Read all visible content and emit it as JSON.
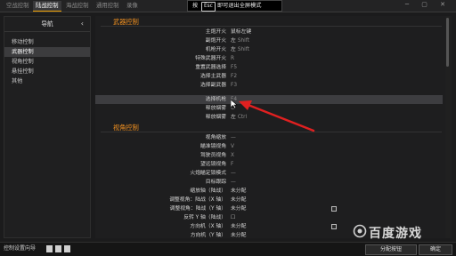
{
  "top_tabs": [
    "空战控制",
    "陆战控制",
    "海战控制",
    "通用控制",
    "录像"
  ],
  "esc_tip": {
    "pre": "按",
    "key": "Esc",
    "post": "即可退出全屏模式"
  },
  "window_buttons": "─ ▢ ✕",
  "sidebar": {
    "title": "导航",
    "items": [
      "移动控制",
      "武器控制",
      "视角控制",
      "悬挂控制",
      "其他"
    ]
  },
  "sections": {
    "weapons": "武器控制",
    "view": "视角控制"
  },
  "weapon_rows": [
    {
      "label": "主炮开火",
      "value": "鼠标左键"
    },
    {
      "label": "副炮开火",
      "prefix": "左",
      "value": "Shift"
    },
    {
      "label": "机枪开火",
      "prefix": "左",
      "value": "Shift"
    },
    {
      "label": "特殊武器开火",
      "value": "R"
    },
    {
      "label": "重置武器选择",
      "value": "F5"
    },
    {
      "label": "选择主武器",
      "value": "F2"
    },
    {
      "label": "选择副武器",
      "value": "F3"
    },
    {
      "label": "选择机枪",
      "value": "F4"
    },
    {
      "label": "释放烟雾",
      "value": "C"
    },
    {
      "label": "释放烟雾",
      "prefix": "左",
      "value": "Ctrl"
    }
  ],
  "view_rows": [
    {
      "label": "视角缩放",
      "value": "—"
    },
    {
      "label": "瞄准镜视角",
      "value": "V"
    },
    {
      "label": "驾驶员视角",
      "value": "X"
    },
    {
      "label": "望远镜视角",
      "value": "F"
    },
    {
      "label": "火炮瞄定锁模式",
      "value": "—"
    },
    {
      "label": "目标跟踪",
      "value": "—"
    },
    {
      "label": "缩放轴（陆战）",
      "value": "未分配"
    },
    {
      "label": "调整视角：陆战（X 轴）",
      "value": "未分配"
    },
    {
      "label": "调整视角：陆战（Y 轴）",
      "value": "未分配"
    },
    {
      "label": "反转 Y 轴（陆战）",
      "value": "☐"
    },
    {
      "label": "方向机（X 轴）",
      "value": "未分配"
    },
    {
      "label": "方向机（Y 轴）",
      "value": "未分配"
    }
  ],
  "bottom": {
    "left_label": "控制设置向导",
    "assign": "分配按钮",
    "ok": "确定"
  },
  "watermark": "百度游戏",
  "colors": {
    "accent": "#f09020",
    "arrow": "#e02020"
  }
}
